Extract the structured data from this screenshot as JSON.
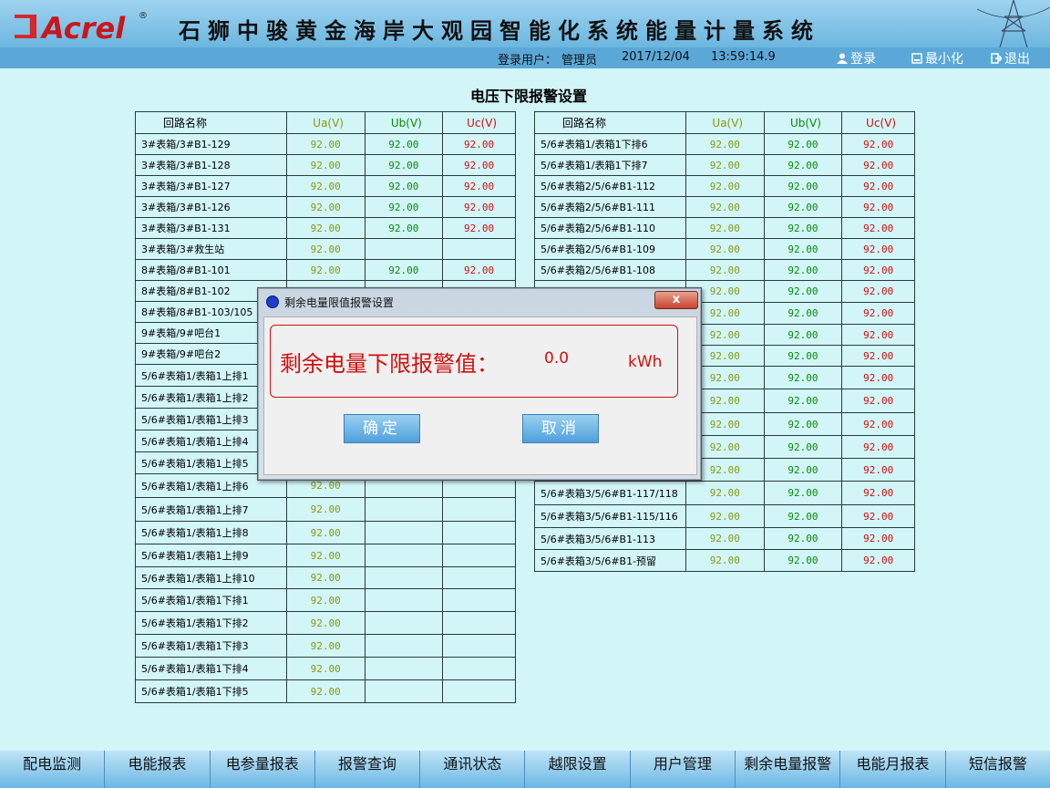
{
  "header": {
    "logo_text": "Acrel",
    "logo_reg": "®",
    "system_title": "石狮中骏黄金海岸大观园智能化系统能量计量系统",
    "login_user_label": "登录用户：",
    "login_user": "管理员",
    "date": "2017/12/04",
    "time": "13:59:14.9",
    "login_btn": "登录",
    "minimize_btn": "最小化",
    "exit_btn": "退出"
  },
  "page_title": "电压下限报警设置",
  "table_headers": {
    "name": "回路名称",
    "ua": "Ua(V)",
    "ub": "Ub(V)",
    "uc": "Uc(V)"
  },
  "left_rows": [
    {
      "name": "3#表箱/3#B1-129",
      "ua": "92.00",
      "ub": "92.00",
      "uc": "92.00"
    },
    {
      "name": "3#表箱/3#B1-128",
      "ua": "92.00",
      "ub": "92.00",
      "uc": "92.00"
    },
    {
      "name": "3#表箱/3#B1-127",
      "ua": "92.00",
      "ub": "92.00",
      "uc": "92.00"
    },
    {
      "name": "3#表箱/3#B1-126",
      "ua": "92.00",
      "ub": "92.00",
      "uc": "92.00"
    },
    {
      "name": "3#表箱/3#B1-131",
      "ua": "92.00",
      "ub": "92.00",
      "uc": "92.00"
    },
    {
      "name": "3#表箱/3#救生站",
      "ua": "92.00",
      "ub": "",
      "uc": ""
    },
    {
      "name": "8#表箱/8#B1-101",
      "ua": "92.00",
      "ub": "92.00",
      "uc": "92.00"
    },
    {
      "name": "8#表箱/8#B1-102",
      "ua": "",
      "ub": "",
      "uc": ""
    },
    {
      "name": "8#表箱/8#B1-103/105",
      "ua": "",
      "ub": "",
      "uc": ""
    },
    {
      "name": "9#表箱/9#吧台1",
      "ua": "",
      "ub": "",
      "uc": ""
    },
    {
      "name": "9#表箱/9#吧台2",
      "ua": "",
      "ub": "",
      "uc": ""
    },
    {
      "name": "5/6#表箱1/表箱1上排1",
      "ua": "",
      "ub": "",
      "uc": ""
    },
    {
      "name": "5/6#表箱1/表箱1上排2",
      "ua": "",
      "ub": "",
      "uc": ""
    },
    {
      "name": "5/6#表箱1/表箱1上排3",
      "ua": "",
      "ub": "",
      "uc": ""
    },
    {
      "name": "5/6#表箱1/表箱1上排4",
      "ua": "",
      "ub": "",
      "uc": ""
    },
    {
      "name": "5/6#表箱1/表箱1上排5",
      "ua": "",
      "ub": "",
      "uc": ""
    },
    {
      "name": "5/6#表箱1/表箱1上排6",
      "ua": "92.00",
      "ub": "",
      "uc": ""
    },
    {
      "name": "5/6#表箱1/表箱1上排7",
      "ua": "92.00",
      "ub": "",
      "uc": ""
    },
    {
      "name": "5/6#表箱1/表箱1上排8",
      "ua": "92.00",
      "ub": "",
      "uc": ""
    },
    {
      "name": "5/6#表箱1/表箱1上排9",
      "ua": "92.00",
      "ub": "",
      "uc": ""
    },
    {
      "name": "5/6#表箱1/表箱1上排10",
      "ua": "92.00",
      "ub": "",
      "uc": ""
    },
    {
      "name": "5/6#表箱1/表箱1下排1",
      "ua": "92.00",
      "ub": "",
      "uc": ""
    },
    {
      "name": "5/6#表箱1/表箱1下排2",
      "ua": "92.00",
      "ub": "",
      "uc": ""
    },
    {
      "name": "5/6#表箱1/表箱1下排3",
      "ua": "92.00",
      "ub": "",
      "uc": ""
    },
    {
      "name": "5/6#表箱1/表箱1下排4",
      "ua": "92.00",
      "ub": "",
      "uc": ""
    },
    {
      "name": "5/6#表箱1/表箱1下排5",
      "ua": "92.00",
      "ub": "",
      "uc": ""
    }
  ],
  "right_rows": [
    {
      "name": "5/6#表箱1/表箱1下排6",
      "ua": "92.00",
      "ub": "92.00",
      "uc": "92.00"
    },
    {
      "name": "5/6#表箱1/表箱1下排7",
      "ua": "92.00",
      "ub": "92.00",
      "uc": "92.00"
    },
    {
      "name": "5/6#表箱2/5/6#B1-112",
      "ua": "92.00",
      "ub": "92.00",
      "uc": "92.00"
    },
    {
      "name": "5/6#表箱2/5/6#B1-111",
      "ua": "92.00",
      "ub": "92.00",
      "uc": "92.00"
    },
    {
      "name": "5/6#表箱2/5/6#B1-110",
      "ua": "92.00",
      "ub": "92.00",
      "uc": "92.00"
    },
    {
      "name": "5/6#表箱2/5/6#B1-109",
      "ua": "92.00",
      "ub": "92.00",
      "uc": "92.00"
    },
    {
      "name": "5/6#表箱2/5/6#B1-108",
      "ua": "92.00",
      "ub": "92.00",
      "uc": "92.00"
    },
    {
      "name": "",
      "ua": "92.00",
      "ub": "92.00",
      "uc": "92.00"
    },
    {
      "name": "",
      "ua": "92.00",
      "ub": "92.00",
      "uc": "92.00"
    },
    {
      "name": "",
      "ua": "92.00",
      "ub": "92.00",
      "uc": "92.00"
    },
    {
      "name": "",
      "ua": "92.00",
      "ub": "92.00",
      "uc": "92.00"
    },
    {
      "name": "",
      "ua": "92.00",
      "ub": "92.00",
      "uc": "92.00"
    },
    {
      "name": "",
      "ua": "92.00",
      "ub": "92.00",
      "uc": "92.00"
    },
    {
      "name": "",
      "ua": "92.00",
      "ub": "92.00",
      "uc": "92.00"
    },
    {
      "name": "",
      "ua": "92.00",
      "ub": "92.00",
      "uc": "92.00"
    },
    {
      "name": "",
      "ua": "92.00",
      "ub": "92.00",
      "uc": "92.00"
    },
    {
      "name": "5/6#表箱3/5/6#B1-117/118",
      "ua": "92.00",
      "ub": "92.00",
      "uc": "92.00"
    },
    {
      "name": "5/6#表箱3/5/6#B1-115/116",
      "ua": "92.00",
      "ub": "92.00",
      "uc": "92.00"
    },
    {
      "name": "5/6#表箱3/5/6#B1-113",
      "ua": "92.00",
      "ub": "92.00",
      "uc": "92.00"
    },
    {
      "name": "5/6#表箱3/5/6#B1-预留",
      "ua": "92.00",
      "ub": "92.00",
      "uc": "92.00"
    }
  ],
  "dialog": {
    "title": "剩余电量限值报警设置",
    "close_label": "x",
    "alarm_label": "剩余电量下限报警值：",
    "alarm_value": "0.0",
    "alarm_unit": "kWh",
    "ok_label": "确定",
    "cancel_label": "取消"
  },
  "nav": [
    {
      "label": "配电监测"
    },
    {
      "label": "电能报表"
    },
    {
      "label": "电参量报表"
    },
    {
      "label": "报警查询"
    },
    {
      "label": "通讯状态"
    },
    {
      "label": "越限设置"
    },
    {
      "label": "用户管理"
    },
    {
      "label": "剩余电量报警"
    },
    {
      "label": "电能月报表"
    },
    {
      "label": "短信报警"
    }
  ],
  "colors": {
    "ua": "#8a9a10",
    "ub": "#0a8a0a",
    "uc": "#d01010",
    "background": "#d2f5f7",
    "alarm": "#d01010"
  }
}
